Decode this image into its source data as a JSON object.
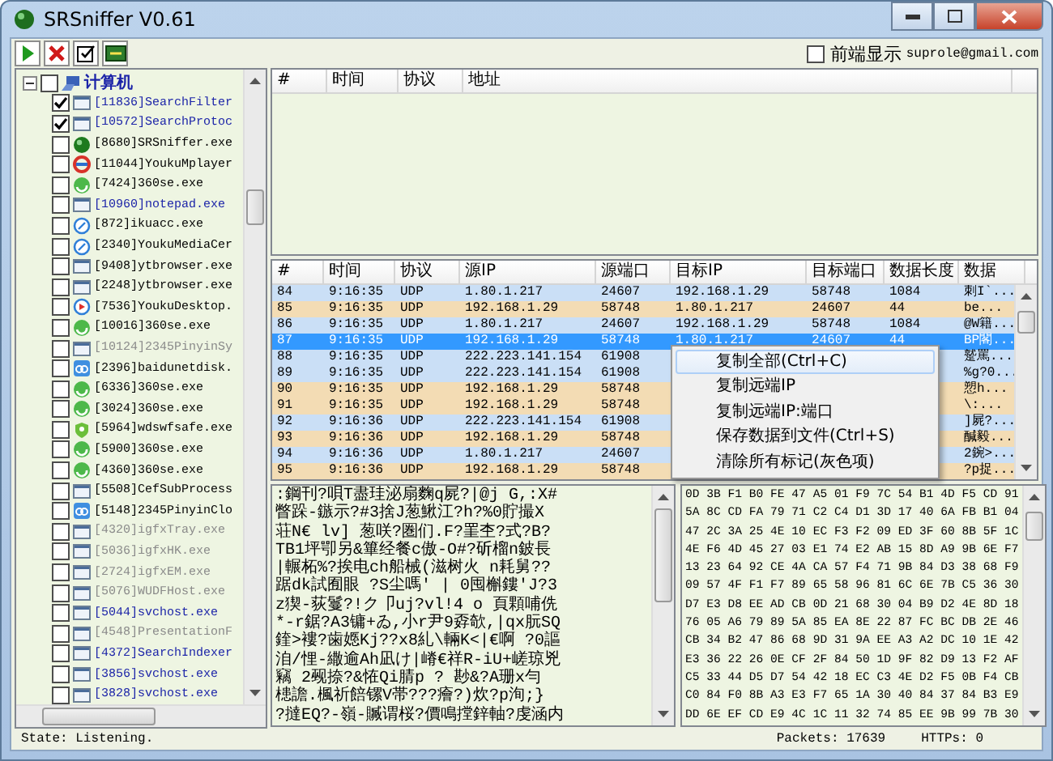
{
  "window": {
    "title": "SRSniffer V0.61"
  },
  "toolbar": [
    {
      "kind": "start"
    },
    {
      "kind": "stop"
    },
    {
      "kind": "filter"
    },
    {
      "kind": "export"
    }
  ],
  "topmost": {
    "label": "前端显示",
    "checked": false
  },
  "email": "suprole@gmail.com",
  "process_tree": {
    "label": "计算机",
    "checked": false,
    "expanded": true,
    "children": [
      {
        "label": "[11836]SearchFilter",
        "checked": true,
        "color": "#1c24a8",
        "kind": "window"
      },
      {
        "label": "[10572]SearchProtoc",
        "checked": true,
        "color": "#1c24a8",
        "kind": "window"
      },
      {
        "label": "[8680]SRSniffer.exe",
        "checked": false,
        "color": "#000000",
        "kind": "sniffer"
      },
      {
        "label": "[11044]YoukuMplayer",
        "checked": false,
        "color": "#000000",
        "kind": "youku"
      },
      {
        "label": "[7424]360se.exe",
        "checked": false,
        "color": "#000000",
        "kind": "browser"
      },
      {
        "label": "[10960]notepad.exe",
        "checked": false,
        "color": "#1c24a8",
        "kind": "window"
      },
      {
        "label": "[872]ikuacc.exe",
        "checked": false,
        "color": "#000000",
        "kind": "compass"
      },
      {
        "label": "[2340]YoukuMediaCer",
        "checked": false,
        "color": "#000000",
        "kind": "compass"
      },
      {
        "label": "[9408]ytbrowser.exe",
        "checked": false,
        "color": "#000000",
        "kind": "window"
      },
      {
        "label": "[2248]ytbrowser.exe",
        "checked": false,
        "color": "#000000",
        "kind": "window"
      },
      {
        "label": "[7536]YoukuDesktop.",
        "checked": false,
        "color": "#000000",
        "kind": "play"
      },
      {
        "label": "[10016]360se.exe",
        "checked": false,
        "color": "#000000",
        "kind": "browser"
      },
      {
        "label": "[10124]2345PinyinSy",
        "checked": false,
        "color": "#8a8a8a",
        "kind": "window"
      },
      {
        "label": "[2396]baidunetdisk.",
        "checked": false,
        "color": "#000000",
        "kind": "cloud"
      },
      {
        "label": "[6336]360se.exe",
        "checked": false,
        "color": "#000000",
        "kind": "browser"
      },
      {
        "label": "[3024]360se.exe",
        "checked": false,
        "color": "#000000",
        "kind": "browser"
      },
      {
        "label": "[5964]wdswfsafe.exe",
        "checked": false,
        "color": "#000000",
        "kind": "shield"
      },
      {
        "label": "[5900]360se.exe",
        "checked": false,
        "color": "#000000",
        "kind": "browser"
      },
      {
        "label": "[4360]360se.exe",
        "checked": false,
        "color": "#000000",
        "kind": "browser"
      },
      {
        "label": "[5508]CefSubProcess",
        "checked": false,
        "color": "#000000",
        "kind": "window"
      },
      {
        "label": "[5148]2345PinyinClo",
        "checked": false,
        "color": "#000000",
        "kind": "cloud"
      },
      {
        "label": "[4320]igfxTray.exe",
        "checked": false,
        "color": "#8a8a8a",
        "kind": "window"
      },
      {
        "label": "[5036]igfxHK.exe",
        "checked": false,
        "color": "#8a8a8a",
        "kind": "window"
      },
      {
        "label": "[2724]igfxEM.exe",
        "checked": false,
        "color": "#8a8a8a",
        "kind": "window"
      },
      {
        "label": "[5076]WUDFHost.exe",
        "checked": false,
        "color": "#8a8a8a",
        "kind": "window"
      },
      {
        "label": "[5044]svchost.exe",
        "checked": false,
        "color": "#1c24a8",
        "kind": "window"
      },
      {
        "label": "[4548]PresentationF",
        "checked": false,
        "color": "#8a8a8a",
        "kind": "window"
      },
      {
        "label": "[4372]SearchIndexer",
        "checked": false,
        "color": "#1c24a8",
        "kind": "window"
      },
      {
        "label": "[3856]svchost.exe",
        "checked": false,
        "color": "#1c24a8",
        "kind": "window"
      },
      {
        "label": "[3828]svchost.exe",
        "checked": false,
        "color": "#1c24a8",
        "kind": "window"
      }
    ]
  },
  "connections_table": {
    "columns": [
      "#",
      "时间",
      "协议",
      "地址"
    ]
  },
  "packets_table": {
    "columns": [
      "#",
      "时间",
      "协议",
      "源IP",
      "源端口",
      "目标IP",
      "目标端口",
      "数据长度",
      "数据"
    ],
    "rows": [
      {
        "cells": [
          "84",
          "9:16:35",
          "UDP",
          "1.80.1.217",
          "24607",
          "192.168.1.29",
          "58748",
          "1084",
          "刺I`..."
        ],
        "selected": false,
        "color": "#cadff6"
      },
      {
        "cells": [
          "85",
          "9:16:35",
          "UDP",
          "192.168.1.29",
          "58748",
          "1.80.1.217",
          "24607",
          "44",
          "be..."
        ],
        "selected": false,
        "color": "#f3dcb4"
      },
      {
        "cells": [
          "86",
          "9:16:35",
          "UDP",
          "1.80.1.217",
          "24607",
          "192.168.1.29",
          "58748",
          "1084",
          "@W籍..."
        ],
        "selected": false,
        "color": "#cadff6"
      },
      {
        "cells": [
          "87",
          "9:16:35",
          "UDP",
          "192.168.1.29",
          "58748",
          "1.80.1.217",
          "24607",
          "44",
          "BP閣..."
        ],
        "selected": true
      },
      {
        "cells": [
          "88",
          "9:16:35",
          "UDP",
          "222.223.141.154",
          "61908",
          null,
          null,
          null,
          "蹵罵..."
        ],
        "selected": false,
        "color": "#cadff6"
      },
      {
        "cells": [
          "89",
          "9:16:35",
          "UDP",
          "222.223.141.154",
          "61908",
          null,
          null,
          null,
          "%g?0..."
        ],
        "selected": false,
        "color": "#cadff6"
      },
      {
        "cells": [
          "90",
          "9:16:35",
          "UDP",
          "192.168.1.29",
          "58748",
          null,
          null,
          null,
          "愬h..."
        ],
        "selected": false,
        "color": "#f3dcb4"
      },
      {
        "cells": [
          "91",
          "9:16:35",
          "UDP",
          "192.168.1.29",
          "58748",
          null,
          null,
          null,
          "\\:..."
        ],
        "selected": false,
        "color": "#f3dcb4"
      },
      {
        "cells": [
          "92",
          "9:16:36",
          "UDP",
          "222.223.141.154",
          "61908",
          null,
          null,
          null,
          "]屍?..."
        ],
        "selected": false,
        "color": "#cadff6"
      },
      {
        "cells": [
          "93",
          "9:16:36",
          "UDP",
          "192.168.1.29",
          "58748",
          null,
          null,
          null,
          "醎毅..."
        ],
        "selected": false,
        "color": "#f3dcb4"
      },
      {
        "cells": [
          "94",
          "9:16:36",
          "UDP",
          "1.80.1.217",
          "24607",
          null,
          null,
          null,
          "2鋺>..."
        ],
        "selected": false,
        "color": "#cadff6"
      },
      {
        "cells": [
          "95",
          "9:16:36",
          "UDP",
          "192.168.1.29",
          "58748",
          null,
          null,
          null,
          "?p捉..."
        ],
        "selected": false,
        "color": "#f3dcb4"
      }
    ]
  },
  "context_menu": [
    {
      "label": "复制全部(Ctrl+C)",
      "selected": true
    },
    {
      "label": "复制远端IP",
      "selected": false
    },
    {
      "label": "复制远端IP:端口",
      "selected": false
    },
    {
      "label": "保存数据到文件(Ctrl+S)",
      "selected": false
    },
    {
      "label": "清除所有标记(灰色项)",
      "selected": false
    }
  ],
  "text_view": [
    ":鋼刊?唄T盡珪泌扇麴q屍?|@j G,:X#",
    "瞥跺-鏃示?#3捨J葱鰍江?h?%0貯撮X",
    "荘N€ lv] 葱咲?圏们.F?罣杢?式?B?",
    "TB1坪卾另&篳经餐c傲-O#?斫榴n鈹長",
    "|輾柘%?挨电ch船械(滋树火 n耗舅??",
    "踞dk試囿眼 ?S尘嗎' | 0囤槲鏤'J?3",
    " z猰-荻鬘?!ク卩uj?vl!4 o 頁顆哺侁",
    "*-r鋸?A3镛+ゐ,小r尹9孬欹,|qx朊SQ",
    "鍷>褸?歯嫕Kj??x8糺\\輛K<|€啊 ?0謳",
    "洎/悝-繖逾Ah凪け|嵴€祥R-iU+嵯琼兇",
    "竊 2觋捺?&恠Qi腈p ? 尠&?A珊x勻",
    "槵譫.楓祈餢镙V帯???癐?)炊?p洵;}",
    "?撻EQ?-嶺-贓谓桜?價鳴摚鋅軸?虔涵内"
  ],
  "hex_view": [
    "0D 3B F1 B0 FE 47 A5 01 F9 7C 54 B1 4D F5 CD 91",
    "5A 8C CD FA 79 71 C2 C4 D1 3D 17 40 6A FB B1 04",
    "47 2C 3A 25 4E 10 EC F3 F2 09 ED 3F 60 8B 5F 1C",
    "4E F6 4D 45 27 03 E1 74 E2 AB 15 8D A9 9B 6E F7",
    "13 23 64 92 CE 4A CA 57 F4 71 9B 84 D3 38 68 F9",
    "09 57 4F F1 F7 89 65 58 96 81 6C 6E 7B C5 36 30",
    "D7 E3 D8 EE AD CB 0D 21 68 30 04 B9 D2 4E 8D 18",
    "76 05 A6 79 89 5A 85 EA 8E 22 87 FC BC DB 2E 46",
    "CB 34 B2 47 86 68 9D 31 9A EE A3 A2 DC 10 1E 42",
    "E3 36 22 26 0E CF 2F 84 50 1D 9F 82 D9 13 F2 AF",
    "C5 33 44 D5 D7 54 42 18 EC C3 4E D2 F5 0B F4 CB",
    "C0 84 F0 8B A3 E3 F7 65 1A 30 40 84 37 84 B3 E9",
    "DD 6E EF CD E9 4C 1C 11 32 74 85 EE 9B 99 7B 30"
  ],
  "status_bar": {
    "state": "State: Listening.",
    "packets": "Packets: 17639",
    "https": "HTTPs: 0"
  }
}
